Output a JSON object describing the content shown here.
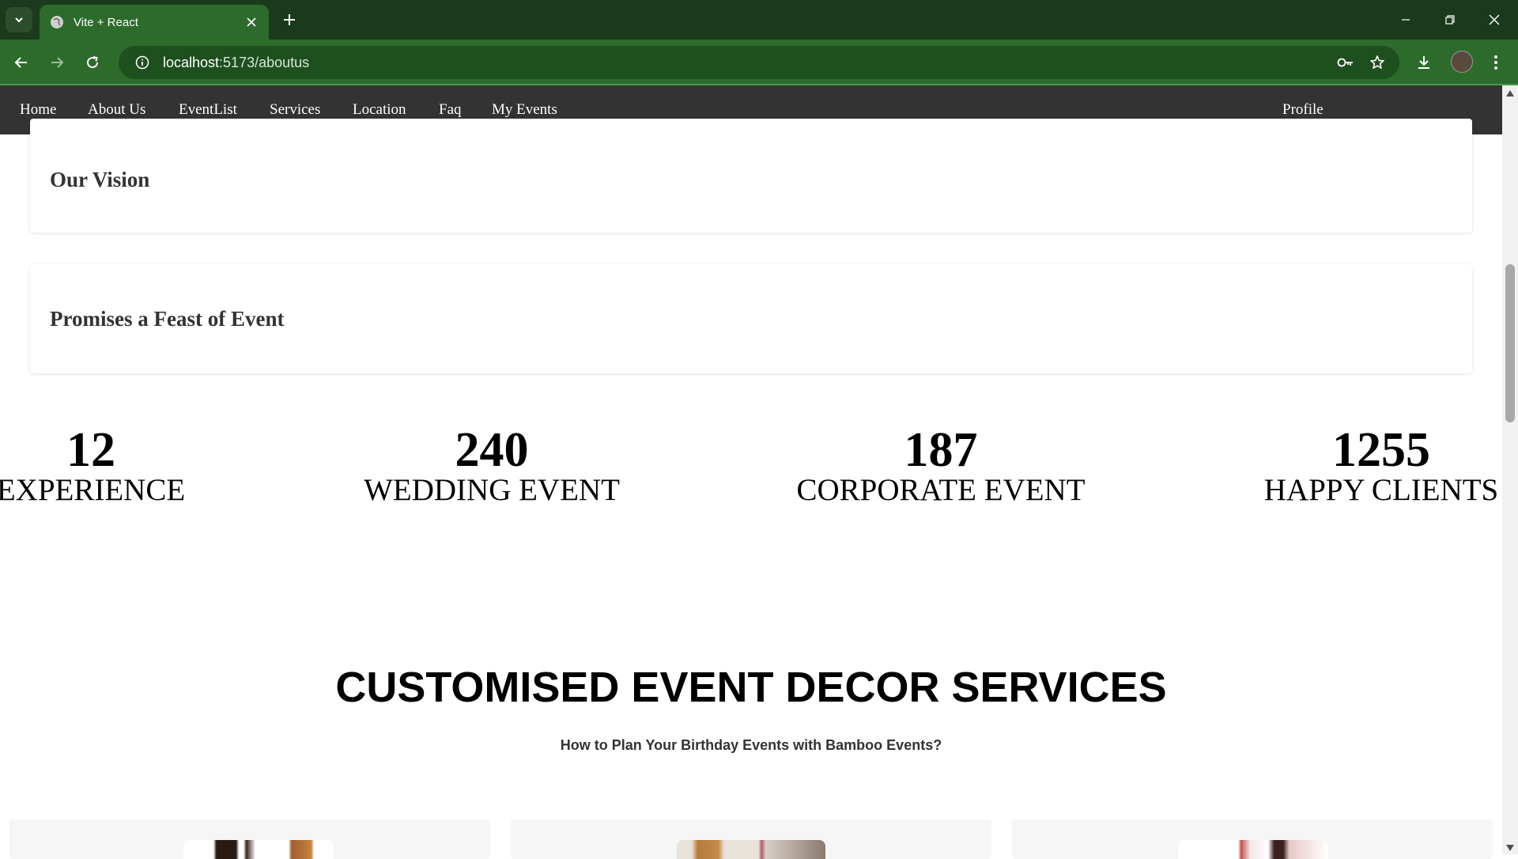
{
  "browser": {
    "tab_title": "Vite + React",
    "url_host": "localhost",
    "url_path": ":5173/aboutus"
  },
  "nav": {
    "items": [
      "Home",
      "About Us",
      "EventList",
      "Services",
      "Location",
      "Faq",
      "My Events"
    ],
    "profile": "Profile"
  },
  "sections": {
    "vision_title": "Our Vision",
    "promise_title": "Promises a Feast of Event"
  },
  "stats": [
    {
      "value": "12",
      "label": "EXPERIENCE"
    },
    {
      "value": "240",
      "label": "WEDDING EVENT"
    },
    {
      "value": "187",
      "label": "CORPORATE EVENT"
    },
    {
      "value": "1255",
      "label": "HAPPY CLIENTS"
    }
  ],
  "decor": {
    "title": "CUSTOMISED EVENT DECOR SERVICES",
    "subtitle": "How to Plan Your Birthday Events with Bamboo Events?"
  },
  "colors": {
    "tabbar": "#1b3a1b",
    "toolbar": "#2c6b2c",
    "nav_bg": "#333333"
  }
}
